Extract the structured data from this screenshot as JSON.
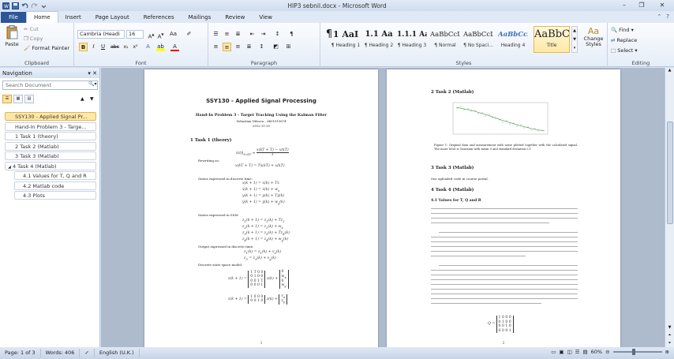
{
  "window": {
    "title": "HIP3 sebnil.docx - Microsoft Word"
  },
  "tabs": [
    {
      "label": "File"
    },
    {
      "label": "Home"
    },
    {
      "label": "Insert"
    },
    {
      "label": "Page Layout"
    },
    {
      "label": "References"
    },
    {
      "label": "Mailings"
    },
    {
      "label": "Review"
    },
    {
      "label": "View"
    }
  ],
  "ribbon": {
    "clipboard": {
      "paste": "Paste",
      "cut": "Cut",
      "copy": "Copy",
      "format_painter": "Format Painter",
      "label": "Clipboard"
    },
    "font": {
      "name": "Cambria (Headi",
      "size": "16",
      "label": "Font"
    },
    "paragraph": {
      "label": "Paragraph"
    },
    "styles": {
      "label": "Styles",
      "tiles": [
        {
          "sample": "¶",
          "name": ""
        },
        {
          "sample": "1 AaI",
          "name": "¶ Heading 1"
        },
        {
          "sample": "1.1 Aa",
          "name": "¶ Heading 2"
        },
        {
          "sample": "1.1.1 Aa",
          "name": "¶ Heading 3"
        },
        {
          "sample": "AaBbCcL",
          "name": "¶ Normal"
        },
        {
          "sample": "AaBbCcL",
          "name": "¶ No Spaci..."
        },
        {
          "sample": "AaBbCcD",
          "name": "Heading 4"
        },
        {
          "sample": "AaBbC",
          "name": "Title"
        }
      ],
      "change_styles": "Change Styles"
    },
    "editing": {
      "find": "Find",
      "replace": "Replace",
      "select": "Select",
      "label": "Editing"
    }
  },
  "navigation": {
    "title": "Navigation",
    "search_placeholder": "Search Document",
    "items": [
      {
        "label": "SSY130 - Applied Signal Pr..."
      },
      {
        "label": "Hand-In Problem 3 - Targe..."
      },
      {
        "label": "1 Task 1 (theory)"
      },
      {
        "label": "2 Task 2 (Matlab)"
      },
      {
        "label": "3 Task 3 (Matlab)"
      },
      {
        "label": "4 Task 4 (Matlab)"
      },
      {
        "label": "4.1 Values for T, Q and R"
      },
      {
        "label": "4.2 Matlab code"
      },
      {
        "label": "4.3 Plots"
      }
    ]
  },
  "page1": {
    "title": "SSY130 - Applied Signal Processing",
    "subtitle": "Hand-In Problem 3 - Target Tracking Using the Kalman Filter",
    "author": "Sebastian Nilsson – 8601015674",
    "date": "2012-11-20",
    "h1": "1    Task 1 (theory)",
    "p1": "Rewriting as:",
    "p2": "States expressed in discrete time:",
    "p3": "States expressed in SSM:",
    "p4": "Output expressed in discrete time:",
    "p5": "Discrete state space model:",
    "page_number": "1"
  },
  "page2": {
    "h2": "2    Task 2 (Matlab)",
    "caption": "Figure 1: Original data and measurement with noise plotted together with the calculated signal. The noise level is Gaussian with mean 0 and standard deviation 0.1",
    "h3": "3    Task 3 (Matlab)",
    "p_t3": "See uploaded code in course portal.",
    "h4": "4    Task 4 (Matlab)",
    "h41": "4.1    Values for T, Q and R",
    "q_label": "Q =",
    "page_number": "2"
  },
  "status": {
    "page": "Page: 1 of 3",
    "words": "Words: 406",
    "language": "English (U.K.)",
    "zoom": "60%"
  }
}
